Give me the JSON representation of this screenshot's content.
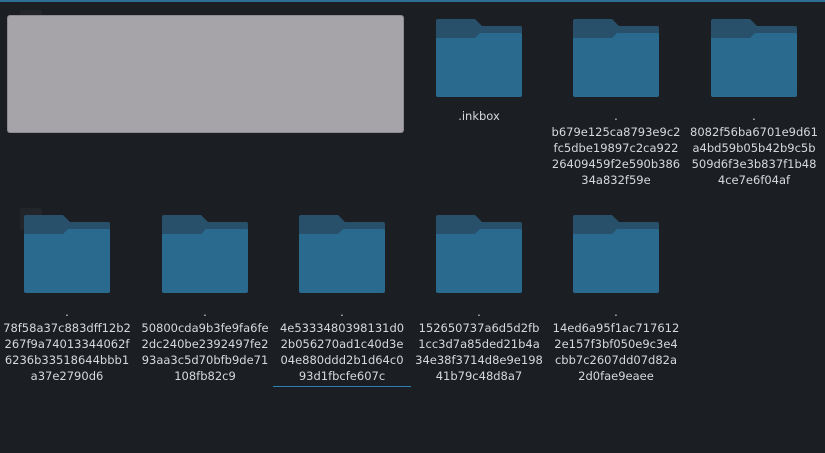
{
  "colors": {
    "background": "#1b1e22",
    "folder_back": "#28506b",
    "folder_front": "#2b6a8f",
    "label": "#d6d9dc",
    "focus_underline": "#2e7fb1",
    "preview": "#a7a4a9"
  },
  "icons": {
    "folder": "folder-icon"
  },
  "items": [
    {
      "label": ".inkbox"
    },
    {
      "label": ".\nb679e125ca8793e9c2\nfc5dbe19897c2ca922\n26409459f2e590b386\n34a832f59e"
    },
    {
      "label": ".\n8082f56ba6701e9d61\na4bd59b05b42b9c5b\n509d6f3e3b837f1b48\n4ce7e6f04af"
    },
    {
      "label": ".\n78f58a37c883dff12b2\n267f9a74013344062f\n6236b33518644bbb1\na37e2790d6"
    },
    {
      "label": ".\n50800cda9b3fe9fa6fe\n2dc240be2392497fe2\n93aa3c5d70bfb9de71\n108fb82c9"
    },
    {
      "label": ".\n4e5333480398131d0\n2b056270ad1c40d3e\n04e880ddd2b1d64c0\n93d1fbcfe607c"
    },
    {
      "label": ".\n152650737a6d5d2fb\n1cc3d7a85ded21b4a\n34e38f3714d8e9e198\n41b79c48d8a7"
    },
    {
      "label": ".\n14ed6a95f1ac717612\n2e157f3bf050e9c3e4\ncbb7c2607dd07d82a\n2d0fae9eaee"
    }
  ]
}
